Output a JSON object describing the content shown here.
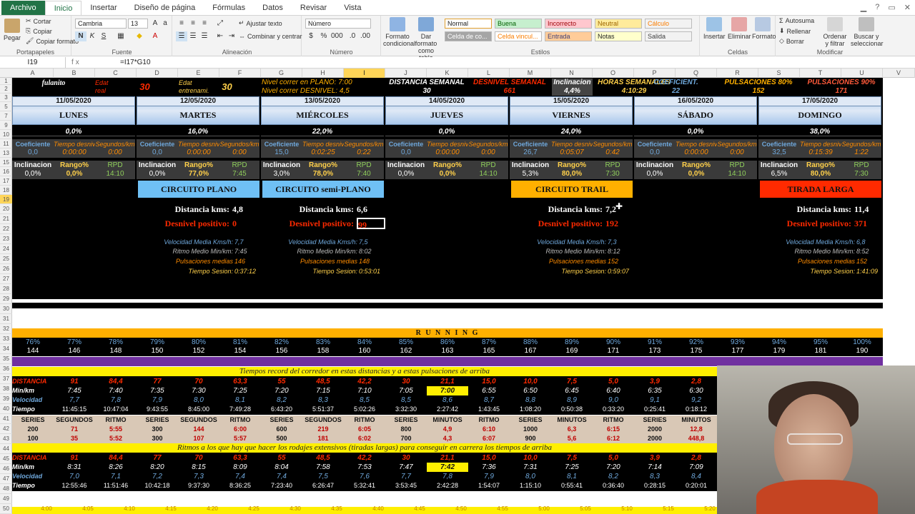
{
  "menu": {
    "file": "Archivo",
    "tabs": [
      "Inicio",
      "Insertar",
      "Diseño de página",
      "Fórmulas",
      "Datos",
      "Revisar",
      "Vista"
    ]
  },
  "ribbon": {
    "paste": "Pegar",
    "cut": "Cortar",
    "copy": "Copiar",
    "copy_format": "Copiar formato",
    "clipboard": "Portapapeles",
    "font_name": "Cambria",
    "font_size": "13",
    "font_group": "Fuente",
    "wrap": "Ajustar texto",
    "merge": "Combinar y centrar",
    "align_group": "Alineación",
    "number_format": "Número",
    "number_group": "Número",
    "cond_format": "Formato condicional",
    "table_format": "Dar formato como tabla",
    "styles": [
      "Normal",
      "Buena",
      "Incorrecto",
      "Neutral",
      "Cálculo",
      "Celda de co...",
      "Celda vincul...",
      "Entrada",
      "Notas",
      "Salida"
    ],
    "styles_group": "Estilos",
    "insert": "Insertar",
    "delete": "Eliminar",
    "format": "Formato",
    "cells_group": "Celdas",
    "autosum": "Autosuma",
    "fill": "Rellenar",
    "clear": "Borrar",
    "sort": "Ordenar y filtrar",
    "find": "Buscar y seleccionar",
    "edit_group": "Modificar"
  },
  "formula_bar": {
    "cell": "I19",
    "fx": "fx",
    "formula": "=I17*G10"
  },
  "columns": [
    "A",
    "B",
    "C",
    "D",
    "E",
    "F",
    "G",
    "H",
    "I",
    "J",
    "K",
    "L",
    "M",
    "N",
    "O",
    "P",
    "Q",
    "R",
    "S",
    "T",
    "U",
    "V"
  ],
  "rows": [
    "1",
    "2",
    "3",
    "5",
    "7",
    "9",
    "10",
    "11",
    "13",
    "15",
    "16",
    "17",
    "18",
    "19",
    "20",
    "21",
    "22",
    "23",
    "24",
    "25",
    "26",
    "27",
    "28",
    "29",
    "30",
    "31",
    "32",
    "33",
    "34",
    "35",
    "36",
    "37",
    "38",
    "39",
    "40",
    "41",
    "42",
    "43",
    "44",
    "45",
    "46",
    "47",
    "48",
    "49",
    "50"
  ],
  "top": {
    "name": "fulanito",
    "edat_real_l": "Edat",
    "edat_real_l2": "real",
    "edat_real": "30",
    "edat_ent_l": "Edat",
    "edat_ent_l2": "entrenami.",
    "edat_ent": "30",
    "plano_l": "Nivel correr en PLANO: 7:00",
    "desn_l": "Nivel correr DESNIVEL: 4,5",
    "dist_l": "DISTANCIA SEMANAL",
    "dist_v": "30",
    "desn_sem_l": "DESNIVEL SEMANAL",
    "desn_sem_v": "661",
    "incl_l": "Inclinacion",
    "incl_v": "4,4%",
    "horas_l": "HORAS SEMANALES",
    "horas_v": "4:10:29",
    "coef_l": "COEFICIENT.",
    "coef_v": "22",
    "p80_l": "PULSACIONES 80%",
    "p80_v": "152",
    "p90_l": "PULSACIONES 90%",
    "p90_v": "171"
  },
  "days": [
    {
      "date": "11/05/2020",
      "name": "LUNES",
      "pct": "0,0%",
      "coef": "0,0",
      "tiempo": "0:00:00",
      "seg": "0:00",
      "incl": "0,0%",
      "rango": "0,0%",
      "rpd": "14:10"
    },
    {
      "date": "12/05/2020",
      "name": "MARTES",
      "pct": "16,0%",
      "coef": "0,0",
      "tiempo": "0:00:00",
      "seg": "0:00",
      "incl": "0,0%",
      "rango": "77,0%",
      "rpd": "7:45"
    },
    {
      "date": "13/05/2020",
      "name": "MIÉRCOLES",
      "pct": "22,0%",
      "coef": "15,0",
      "tiempo": "0:02:25",
      "seg": "0:22",
      "incl": "3,0%",
      "rango": "78,0%",
      "rpd": "7:40"
    },
    {
      "date": "14/05/2020",
      "name": "JUEVES",
      "pct": "0,0%",
      "coef": "0,0",
      "tiempo": "0:00:00",
      "seg": "0:00",
      "incl": "0,0%",
      "rango": "0,0%",
      "rpd": "14:10"
    },
    {
      "date": "15/05/2020",
      "name": "VIERNES",
      "pct": "24,0%",
      "coef": "26,7",
      "tiempo": "0:05:07",
      "seg": "0:42",
      "incl": "5,3%",
      "rango": "80,0%",
      "rpd": "7:30"
    },
    {
      "date": "16/05/2020",
      "name": "SÁBADO",
      "pct": "0,0%",
      "coef": "0,0",
      "tiempo": "0:00:00",
      "seg": "0:00",
      "incl": "0,0%",
      "rango": "0,0%",
      "rpd": "14:10"
    },
    {
      "date": "17/05/2020",
      "name": "DOMINGO",
      "pct": "38,0%",
      "coef": "32,5",
      "tiempo": "0:15:39",
      "seg": "1:22",
      "incl": "6,5%",
      "rango": "80,0%",
      "rpd": "7:30"
    }
  ],
  "sub_labels": {
    "coef": "Coeficiente",
    "tiempo": "Tiempo desniv.",
    "seg": "Segundos/km",
    "incl": "Inclinacion",
    "rango": "Rango%",
    "rpd": "RPD"
  },
  "circuits": [
    {
      "title": "CIRCUITO PLANO",
      "dist": "4,8",
      "desn": "0",
      "vel": "7,7",
      "ritmo": "7:45",
      "puls": "146",
      "tiempo": "0:37:12"
    },
    {
      "title": "CIRCUITO semi-PLANO",
      "dist": "6,6",
      "desn": "99",
      "vel": "7,5",
      "ritmo": "8:02",
      "puls": "148",
      "tiempo": "0:53:01"
    },
    {
      "title": "CIRCUITO TRAIL",
      "dist": "7,2",
      "desn": "192",
      "vel": "7,3",
      "ritmo": "8:12",
      "puls": "152",
      "tiempo": "0:59:07"
    },
    {
      "title": "TIRADA LARGA",
      "dist": "11,4",
      "desn": "371",
      "vel": "6,8",
      "ritmo": "8:52",
      "puls": "152",
      "tiempo": "1:41:09"
    }
  ],
  "circ_labels": {
    "dist": "Distancia kms:",
    "desn": "Desnivel positivo:",
    "vel": "Velocidad Media Kms/h:",
    "ritmo": "Ritmo Medio Min/km:",
    "puls": "Pulsaciones medias",
    "tiempo": "Tiempo Sesion:"
  },
  "running": {
    "title": "R U N N I N G",
    "pcts": [
      "76%",
      "77%",
      "78%",
      "79%",
      "80%",
      "81%",
      "82%",
      "83%",
      "84%",
      "85%",
      "86%",
      "87%",
      "88%",
      "89%",
      "90%",
      "91%",
      "92%",
      "93%",
      "94%",
      "95%",
      "100%"
    ],
    "bpm": [
      "144",
      "146",
      "148",
      "150",
      "152",
      "154",
      "156",
      "158",
      "160",
      "162",
      "163",
      "165",
      "167",
      "169",
      "171",
      "173",
      "175",
      "177",
      "179",
      "181",
      "190"
    ]
  },
  "records": {
    "title": "Tiempos record del corredor en estas distancias y a estas pulsaciones de arriba",
    "labels": [
      "DISTANCIA",
      "Min/km",
      "Velocidad",
      "Tiempo"
    ],
    "dist": [
      "91",
      "84,4",
      "77",
      "70",
      "63,3",
      "55",
      "48,5",
      "42,2",
      "30",
      "21,1",
      "15,0",
      "10,0",
      "7,5",
      "5,0",
      "3,9",
      "2,8"
    ],
    "minkm": [
      "7:45",
      "7:40",
      "7:35",
      "7:30",
      "7:25",
      "7:20",
      "7:15",
      "7:10",
      "7:05",
      "7:00",
      "6:55",
      "6:50",
      "6:45",
      "6:40",
      "6:35",
      "6:30"
    ],
    "vel": [
      "7,7",
      "7,8",
      "7,9",
      "8,0",
      "8,1",
      "8,2",
      "8,3",
      "8,5",
      "8,5",
      "8,6",
      "8,7",
      "8,8",
      "8,9",
      "9,0",
      "9,1",
      "9,2"
    ],
    "tiempo": [
      "11:45:15",
      "10:47:04",
      "9:43:55",
      "8:45:00",
      "7:49:28",
      "6:43:20",
      "5:51:37",
      "5:02:26",
      "3:32:30",
      "2:27:42",
      "1:43:45",
      "1:08:20",
      "0:50:38",
      "0:33:20",
      "0:25:41",
      "0:18:12"
    ]
  },
  "series": {
    "headers": [
      "SERIES",
      "SEGUNDOS",
      "RITMO",
      "SERIES",
      "SEGUNDOS",
      "RITMO",
      "SERIES",
      "SEGUNDOS",
      "RITMO",
      "SERIES",
      "MINUTOS",
      "RITMO",
      "SERIES",
      "MINUTOS",
      "RITMO",
      "SERIES",
      "MINUTOS",
      "RITMO"
    ],
    "r41": [
      "200",
      "71",
      "5:55",
      "300",
      "144",
      "6:00",
      "600",
      "219",
      "6:05",
      "800",
      "4,9",
      "6:10",
      "1000",
      "6,3",
      "6:15",
      "2000",
      "12,8",
      "..."
    ],
    "r42": [
      "100",
      "35",
      "5:52",
      "300",
      "107",
      "5:57",
      "500",
      "181",
      "6:02",
      "700",
      "4,3",
      "6:07",
      "900",
      "5,6",
      "6:12",
      "2000",
      "448,8",
      ""
    ]
  },
  "rodajes": {
    "title": "Ritmos a los que hay que hacer los rodajes extensivos (tiradas largas) para conseguir en carrera los tiempos de arriba",
    "dist": [
      "91",
      "84,4",
      "77",
      "70",
      "63,3",
      "55",
      "48,5",
      "42,2",
      "30",
      "21,1",
      "15,0",
      "10,0",
      "7,5",
      "5,0",
      "3,9",
      "2,8"
    ],
    "minkm": [
      "8:31",
      "8:26",
      "8:20",
      "8:15",
      "8:09",
      "8:04",
      "7:58",
      "7:53",
      "7:47",
      "7:42",
      "7:36",
      "7:31",
      "7:25",
      "7:20",
      "7:14",
      "7:09"
    ],
    "vel": [
      "7,0",
      "7,1",
      "7,2",
      "7,3",
      "7,4",
      "7,4",
      "7,5",
      "7,6",
      "7,7",
      "7,8",
      "7,9",
      "8,0",
      "8,1",
      "8,2",
      "8,3",
      "8,4"
    ],
    "tiempo": [
      "12:55:46",
      "11:51:46",
      "10:42:18",
      "9:37:30",
      "8:36:25",
      "7:23:40",
      "6:26:47",
      "5:32:41",
      "3:53:45",
      "2:42:28",
      "1:54:07",
      "1:15:10",
      "0:55:41",
      "0:36:40",
      "0:28:15",
      "0:20:01"
    ]
  },
  "bottom_row": [
    "4:00",
    "4:05",
    "4:10",
    "4:15",
    "4:20",
    "4:25",
    "4:30",
    "4:35",
    "4:40",
    "4:45",
    "4:50",
    "4:55",
    "5:00",
    "5:05",
    "5:10",
    "5:15",
    "5:20"
  ],
  "colors": {
    "dark": "#000000",
    "blue": "#6fa8dc",
    "orange": "#ffb000",
    "red": "#ff2a00",
    "yellow": "#ffef00",
    "purple": "#7030a0",
    "accent": "#217346"
  }
}
